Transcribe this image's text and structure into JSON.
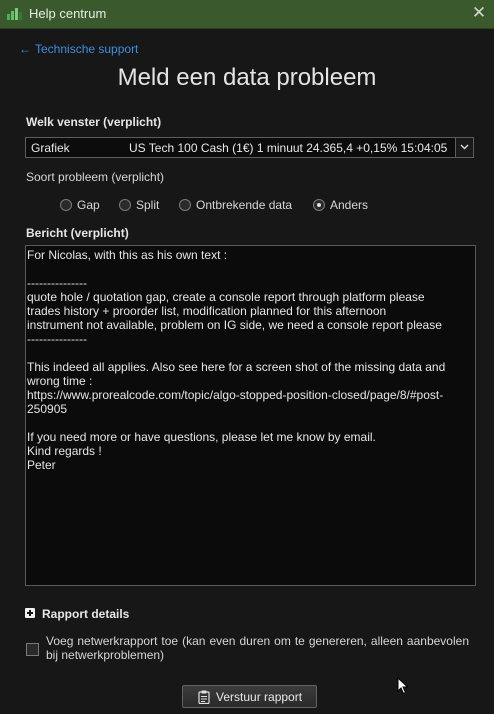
{
  "window": {
    "title": "Help centrum",
    "close_icon": "close-icon"
  },
  "nav": {
    "back_label": "Technische support"
  },
  "form": {
    "title": "Meld een data probleem",
    "window_label": "Welk venster (verplicht)",
    "window_select": {
      "type": "Grafiek",
      "value": "US Tech 100 Cash (1€) 1 minuut 24.365,4 +0,15% 15:04:05"
    },
    "problem_label": "Soort probleem (verplicht)",
    "problem_options": [
      {
        "label": "Gap",
        "checked": false
      },
      {
        "label": "Split",
        "checked": false
      },
      {
        "label": "Ontbrekende data",
        "checked": false
      },
      {
        "label": "Anders",
        "checked": true
      }
    ],
    "message_label": "Bericht (verplicht)",
    "message_text": "For Nicolas, with this as his own text :\n\n---------------\nquote hole / quotation gap, create a console report through platform please\ntrades history + proorder list, modification planned for this afternoon\ninstrument not available, problem on IG side, we need a console report please\n---------------\n\nThis indeed all applies. Also see here for a screen shot of the missing data and wrong time :\nhttps://www.prorealcode.com/topic/algo-stopped-position-closed/page/8/#post-250905\n\nIf you need more or have questions, please let me know by email.\nKind regards !\nPeter",
    "details_label": "Rapport details",
    "network_checkbox_label": "Voeg netwerkrapport toe (kan even duren om te genereren, alleen aanbevolen bij netwerkproblemen)",
    "network_checkbox_checked": false,
    "submit_label": "Verstuur rapport"
  },
  "colors": {
    "titlebar": "#3a5a2e",
    "link": "#3d8fe0",
    "background": "#171717"
  }
}
